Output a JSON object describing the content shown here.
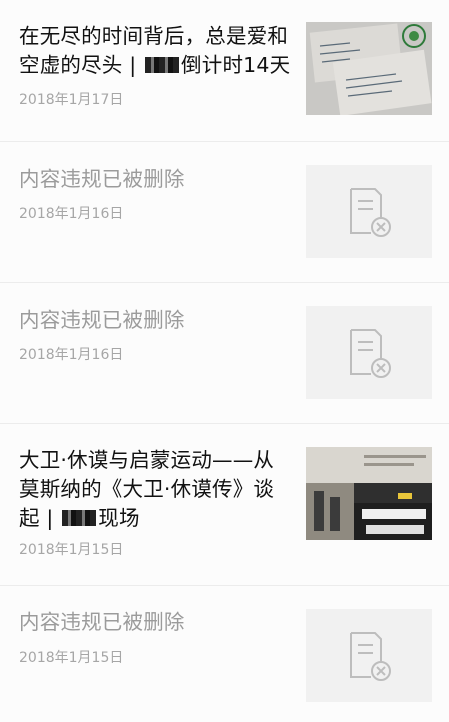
{
  "articles": [
    {
      "title_before": "在无尽的时间背后，总是爱和空虚的尽头 | ",
      "title_after": "倒计时14天",
      "date": "2018年1月17日",
      "deleted": false
    },
    {
      "title": "内容违规已被删除",
      "date": "2018年1月16日",
      "deleted": true
    },
    {
      "title": "内容违规已被删除",
      "date": "2018年1月16日",
      "deleted": true
    },
    {
      "title_before": "大卫·休谟与启蒙运动——从莫斯纳的《大卫·休谟传》谈起 | ",
      "title_after": "现场",
      "date": "2018年1月15日",
      "deleted": false
    },
    {
      "title": "内容违规已被删除",
      "date": "2018年1月15日",
      "deleted": true
    }
  ],
  "colors": {
    "title": "#111111",
    "deleted_title": "#9b9b9b",
    "date": "#a6a6a6",
    "divider": "#ececec"
  },
  "icons": {
    "deleted_thumb": "deleted-document-icon"
  }
}
